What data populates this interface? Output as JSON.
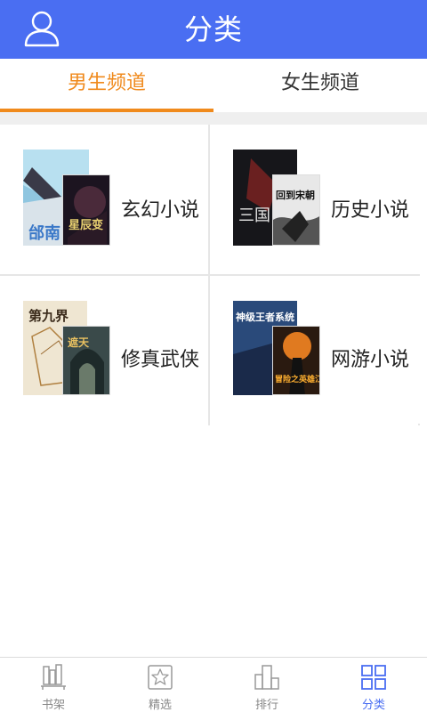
{
  "header": {
    "title": "分类",
    "profile_icon": "user-icon"
  },
  "tabs": [
    {
      "label": "男生频道",
      "active": true
    },
    {
      "label": "女生频道",
      "active": false
    }
  ],
  "categories": [
    {
      "label": "玄幻小说",
      "back_cover_text": "邰南",
      "front_cover_text": "星辰变"
    },
    {
      "label": "历史小说",
      "back_cover_text": "三国",
      "front_cover_text": "回到宋朝"
    },
    {
      "label": "修真武侠",
      "back_cover_text": "第九界",
      "front_cover_text": "遮天"
    },
    {
      "label": "网游小说",
      "back_cover_text": "神级王者系统",
      "front_cover_text": "冒险之英雄江湖"
    }
  ],
  "bottom_nav": [
    {
      "label": "书架",
      "icon": "bookshelf-icon",
      "active": false
    },
    {
      "label": "精选",
      "icon": "star-icon",
      "active": false
    },
    {
      "label": "排行",
      "icon": "ranking-icon",
      "active": false
    },
    {
      "label": "分类",
      "icon": "grid-icon",
      "active": true
    }
  ],
  "colors": {
    "header": "#4a6ef2",
    "accent": "#f08a1c",
    "nav_active": "#4a6ef2"
  }
}
